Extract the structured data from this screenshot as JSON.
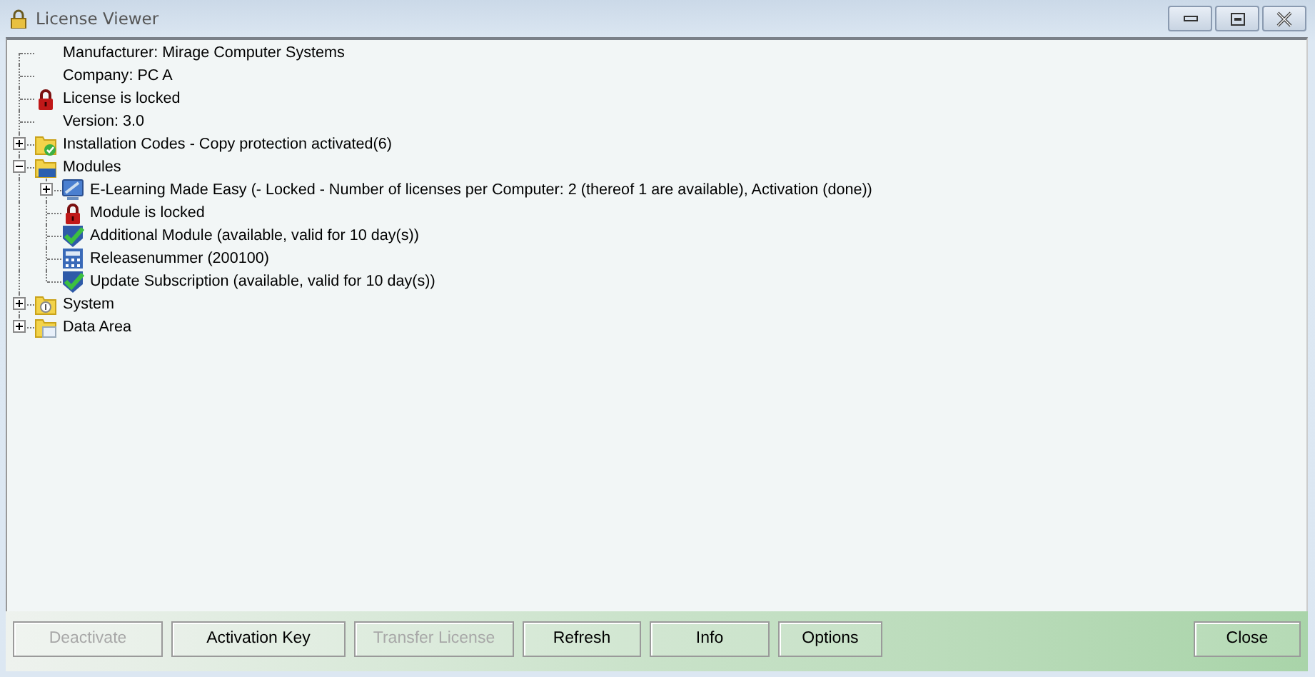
{
  "window": {
    "title": "License Viewer",
    "controls": [
      {
        "kind": "minimize"
      },
      {
        "kind": "maximize"
      },
      {
        "kind": "close"
      }
    ]
  },
  "tree": [
    {
      "label": "Manufacturer: Mirage Computer Systems",
      "kind": "text"
    },
    {
      "label": "Company: PC A",
      "kind": "text"
    },
    {
      "label": "License is locked",
      "kind": "lock"
    },
    {
      "label": "Version: 3.0",
      "kind": "text"
    },
    {
      "label": "Installation Codes - Copy protection activated(6)",
      "kind": "codes",
      "expanded": false
    },
    {
      "label": "Modules",
      "kind": "folder",
      "expanded": true,
      "children": [
        {
          "label": "E-Learning Made Easy (- Locked - Number of licenses per Computer: 2 (thereof 1 are available), Activation (done))",
          "kind": "module",
          "expanded": false
        },
        {
          "label": "Module is locked",
          "kind": "lock"
        },
        {
          "label": "Additional Module (available, valid for 10 day(s))",
          "kind": "valid"
        },
        {
          "label": "Releasenummer (200100)",
          "kind": "release"
        },
        {
          "label": "Update Subscription (available, valid for 10 day(s))",
          "kind": "valid"
        }
      ]
    },
    {
      "label": "System",
      "kind": "system",
      "expanded": false
    },
    {
      "label": "Data Area",
      "kind": "data",
      "expanded": false
    }
  ],
  "buttons": [
    {
      "label": "Deactivate",
      "disabled": true
    },
    {
      "label": "Activation Key",
      "disabled": false
    },
    {
      "label": "Transfer License",
      "disabled": true
    },
    {
      "label": "Refresh",
      "disabled": false
    },
    {
      "label": "Info",
      "disabled": false
    },
    {
      "label": "Options",
      "disabled": false
    }
  ],
  "close_button": {
    "label": "Close"
  }
}
